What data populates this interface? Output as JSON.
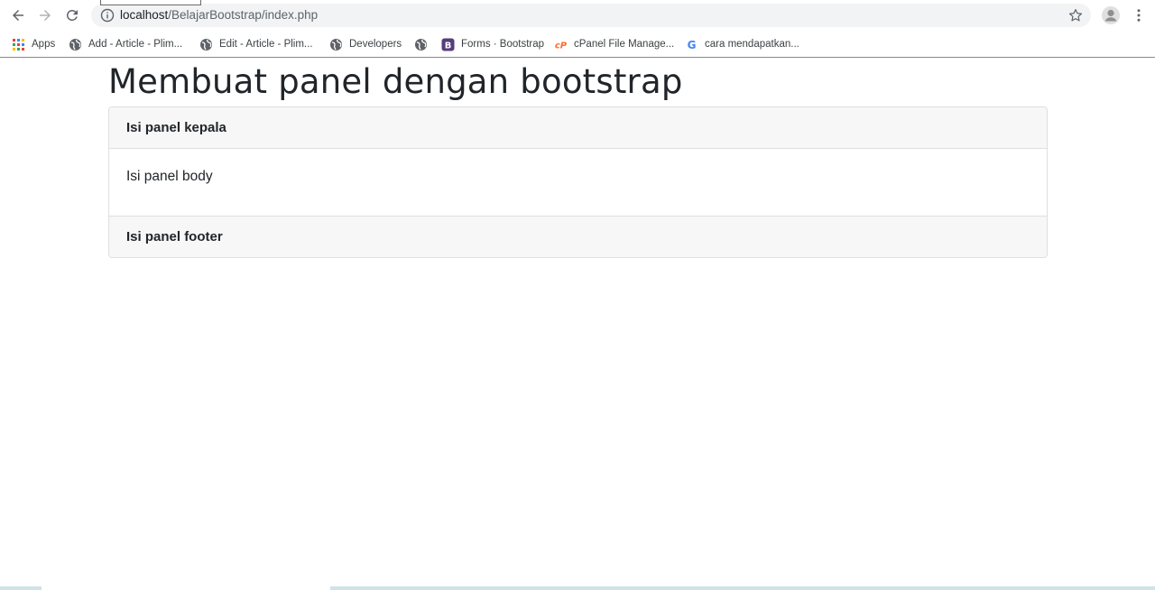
{
  "browser": {
    "url_host": "localhost",
    "url_path": "/BelajarBootstrap/index.php"
  },
  "bookmarks": [
    {
      "label": "Apps",
      "icon": "apps-grid-icon"
    },
    {
      "label": "Add - Article - Plim...",
      "icon": "globe-icon"
    },
    {
      "label": "Edit - Article - Plim...",
      "icon": "globe-icon"
    },
    {
      "label": "Developers",
      "icon": "globe-icon"
    },
    {
      "label": "",
      "icon": "globe-icon"
    },
    {
      "label": "Forms · Bootstrap",
      "icon": "bootstrap-icon"
    },
    {
      "label": "cPanel File Manage...",
      "icon": "cpanel-icon"
    },
    {
      "label": "cara mendapatkan...",
      "icon": "google-icon"
    }
  ],
  "page": {
    "title": "Membuat panel dengan bootstrap",
    "panel": {
      "header": "Isi panel kepala",
      "body": "Isi panel body",
      "footer": "Isi panel footer"
    }
  },
  "colors": {
    "panel_bg": "#f7f7f7",
    "panel_border": "#dfdfdf",
    "text": "#212529",
    "bootstrap_purple": "#563d7c",
    "cpanel_orange": "#ff6c2c"
  }
}
